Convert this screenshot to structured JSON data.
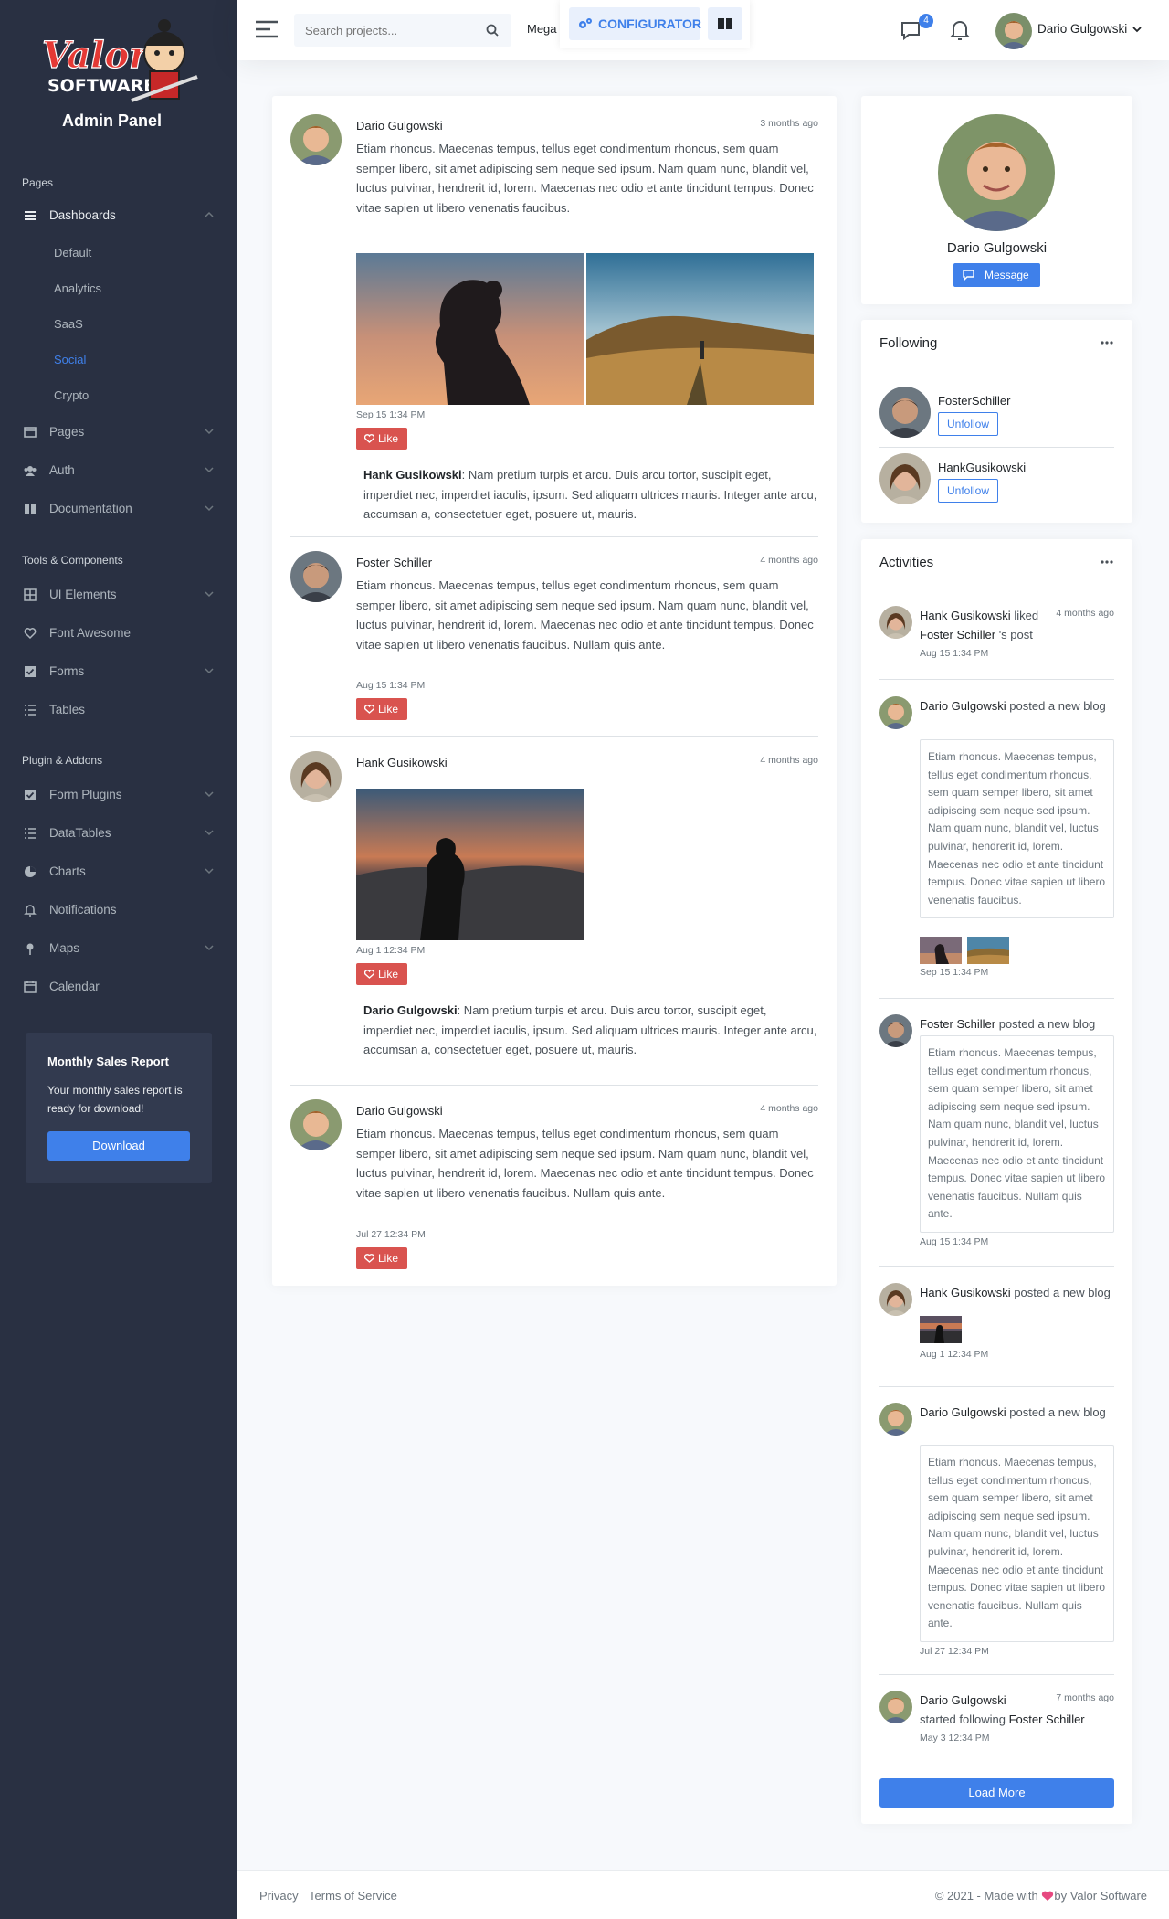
{
  "brand": {
    "logo_text": "Valor SOFTWARE",
    "title": "Admin Panel"
  },
  "sidebar": {
    "headers": [
      "Pages",
      "Tools & Components",
      "Plugin & Addons"
    ],
    "dashboards": {
      "label": "Dashboards",
      "items": [
        "Default",
        "Analytics",
        "SaaS",
        "Social",
        "Crypto"
      ],
      "active": "Social"
    },
    "pages_group": [
      "Pages",
      "Auth",
      "Documentation"
    ],
    "tools_group": [
      "UI Elements",
      "Font Awesome",
      "Forms",
      "Tables"
    ],
    "plugins_group": [
      "Form Plugins",
      "DataTables",
      "Charts",
      "Notifications",
      "Maps",
      "Calendar"
    ],
    "sales": {
      "title": "Monthly Sales Report",
      "text": "Your monthly sales report is ready for download!",
      "button": "Download"
    }
  },
  "topbar": {
    "search_placeholder": "Search projects...",
    "mega": "Mega",
    "configurator": "CONFIGURATOR",
    "message_count": "4",
    "user_name": "Dario Gulgowski"
  },
  "feed": {
    "posts": [
      {
        "name": "Dario Gulgowski",
        "time": "3 months ago",
        "text": "Etiam rhoncus. Maecenas tempus, tellus eget condimentum rhoncus, sem quam semper libero, sit amet adipiscing sem neque sed ipsum. Nam quam nunc, blandit vel, luctus pulvinar, hendrerit id, lorem. Maecenas nec odio et ante tincidunt tempus. Donec vitae sapien ut libero venenatis faucibus.",
        "date": "Sep 15 1:34 PM",
        "like": "Like",
        "comment_author": "Hank Gusikowski",
        "comment": ": Nam pretium turpis et arcu. Duis arcu tortor, suscipit eget, imperdiet nec, imperdiet iaculis, ipsum. Sed aliquam ultrices mauris. Integer ante arcu, accumsan a, consectetuer eget, posuere ut, mauris."
      },
      {
        "name": "Foster Schiller",
        "time": "4 months ago",
        "text": "Etiam rhoncus. Maecenas tempus, tellus eget condimentum rhoncus, sem quam semper libero, sit amet adipiscing sem neque sed ipsum. Nam quam nunc, blandit vel, luctus pulvinar, hendrerit id, lorem. Maecenas nec odio et ante tincidunt tempus. Donec vitae sapien ut libero venenatis faucibus. Nullam quis ante.",
        "date": "Aug 15 1:34 PM",
        "like": "Like"
      },
      {
        "name": "Hank Gusikowski",
        "time": "4 months ago",
        "date": "Aug 1 12:34 PM",
        "like": "Like",
        "comment_author": "Dario Gulgowski",
        "comment": ": Nam pretium turpis et arcu. Duis arcu tortor, suscipit eget, imperdiet nec, imperdiet iaculis, ipsum. Sed aliquam ultrices mauris. Integer ante arcu, accumsan a, consectetuer eget, posuere ut, mauris."
      },
      {
        "name": "Dario Gulgowski",
        "time": "4 months ago",
        "text": "Etiam rhoncus. Maecenas tempus, tellus eget condimentum rhoncus, sem quam semper libero, sit amet adipiscing sem neque sed ipsum. Nam quam nunc, blandit vel, luctus pulvinar, hendrerit id, lorem. Maecenas nec odio et ante tincidunt tempus. Donec vitae sapien ut libero venenatis faucibus. Nullam quis ante.",
        "date": "Jul 27 12:34 PM",
        "like": "Like"
      }
    ]
  },
  "profile": {
    "name": "Dario Gulgowski",
    "button": "Message"
  },
  "following": {
    "title": "Following",
    "items": [
      {
        "name": "FosterSchiller",
        "button": "Unfollow"
      },
      {
        "name": "HankGusikowski",
        "button": "Unfollow"
      }
    ]
  },
  "activities": {
    "title": "Activities",
    "items": [
      {
        "actor": "Hank Gusikowski",
        "action": " liked ",
        "target": "Foster Schiller",
        "suffix": " 's post",
        "time": "4 months ago",
        "date": "Aug 15 1:34 PM"
      },
      {
        "actor": "Dario Gulgowski",
        "action": " posted a new blog",
        "quote": "Etiam rhoncus. Maecenas tempus, tellus eget condimentum rhoncus, sem quam semper libero, sit amet adipiscing sem neque sed ipsum. Nam quam nunc, blandit vel, luctus pulvinar, hendrerit id, lorem. Maecenas nec odio et ante tincidunt tempus. Donec vitae sapien ut libero venenatis faucibus.",
        "date": "Sep 15 1:34 PM"
      },
      {
        "actor": "Foster Schiller",
        "action": " posted a new blog",
        "quote": "Etiam rhoncus. Maecenas tempus, tellus eget condimentum rhoncus, sem quam semper libero, sit amet adipiscing sem neque sed ipsum. Nam quam nunc, blandit vel, luctus pulvinar, hendrerit id, lorem. Maecenas nec odio et ante tincidunt tempus. Donec vitae sapien ut libero venenatis faucibus. Nullam quis ante.",
        "date": "Aug 15 1:34 PM"
      },
      {
        "actor": "Hank Gusikowski",
        "action": " posted a new blog",
        "date": "Aug 1 12:34 PM"
      },
      {
        "actor": "Dario Gulgowski",
        "action": " posted a new blog",
        "quote": "Etiam rhoncus. Maecenas tempus, tellus eget condimentum rhoncus, sem quam semper libero, sit amet adipiscing sem neque sed ipsum. Nam quam nunc, blandit vel, luctus pulvinar, hendrerit id, lorem. Maecenas nec odio et ante tincidunt tempus. Donec vitae sapien ut libero venenatis faucibus. Nullam quis ante.",
        "date": "Jul 27 12:34 PM"
      },
      {
        "actor": "Dario Gulgowski",
        "action": "started following ",
        "target": "Foster Schiller",
        "time": "7 months ago",
        "date": "May 3 12:34 PM"
      }
    ],
    "load_more": "Load More"
  },
  "footer": {
    "privacy": "Privacy",
    "terms": "Terms of Service",
    "copy_pre": "© 2021 - Made with",
    "copy_post": "by Valor Software"
  },
  "colors": {
    "primary": "#3f80ea",
    "sidebar": "#293042",
    "danger": "#d9534f"
  }
}
